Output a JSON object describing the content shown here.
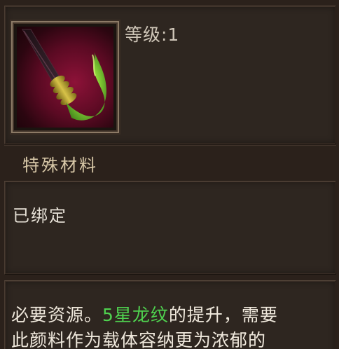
{
  "item": {
    "level_label": "等级:1",
    "category": "特殊材料",
    "bound_status": "已绑定",
    "description": {
      "line1_prefix": "必要资源。",
      "line1_highlight": "5星龙纹",
      "line1_suffix": "的提升，需要",
      "line2": "此颜料作为载体容纳更为浓郁的"
    }
  },
  "colors": {
    "highlight": "#4fd24f",
    "background": "#2b211b",
    "frame_border": "#8c7a66"
  },
  "icon": "dragon-brush-icon"
}
